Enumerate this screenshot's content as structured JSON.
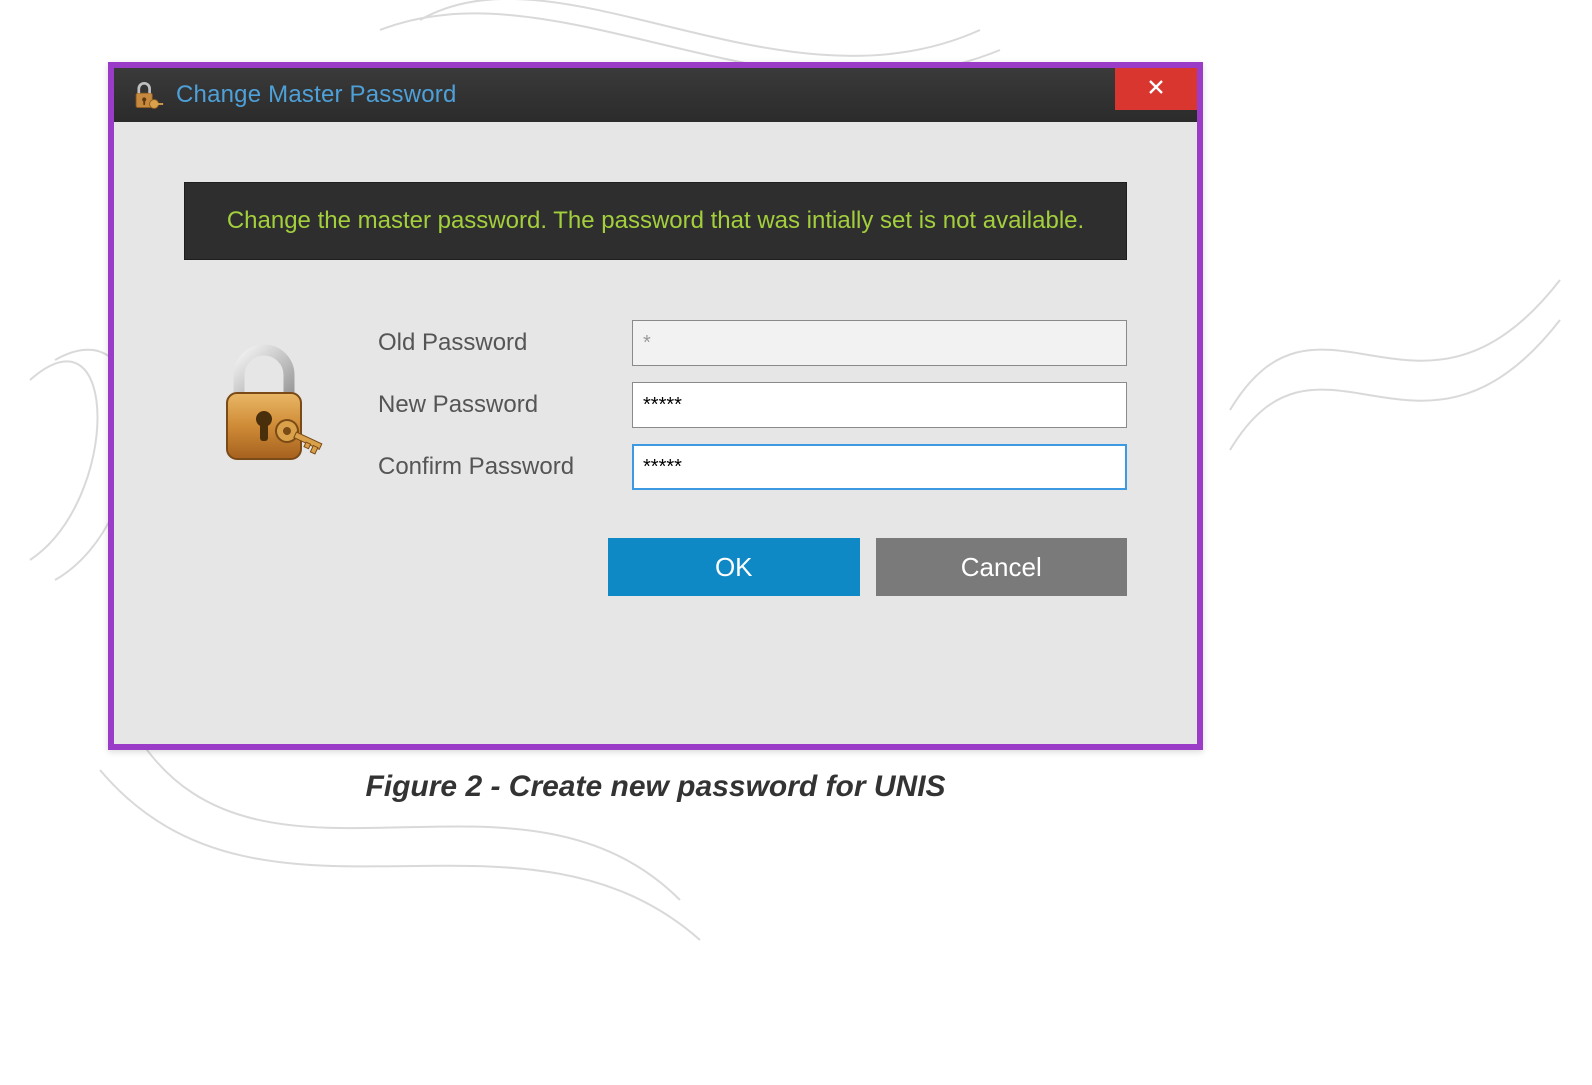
{
  "window": {
    "title": "Change Master Password",
    "close_icon": "close-icon"
  },
  "info_message": "Change the master password. The password that was intially set is not available.",
  "fields": {
    "old_password": {
      "label": "Old Password",
      "value": "*",
      "disabled": true
    },
    "new_password": {
      "label": "New Password",
      "value": "*****"
    },
    "confirm_password": {
      "label": "Confirm Password",
      "value": "*****"
    }
  },
  "buttons": {
    "ok": "OK",
    "cancel": "Cancel"
  },
  "caption": "Figure 2 - Create new password for UNIS",
  "colors": {
    "frame_border": "#9b3cc9",
    "title_text": "#4ea0d8",
    "banner_bg": "#2e2e2e",
    "banner_text": "#a3cf3c",
    "primary_btn": "#0e89c5",
    "secondary_btn": "#7a7a7a",
    "close_btn": "#d9362f"
  }
}
